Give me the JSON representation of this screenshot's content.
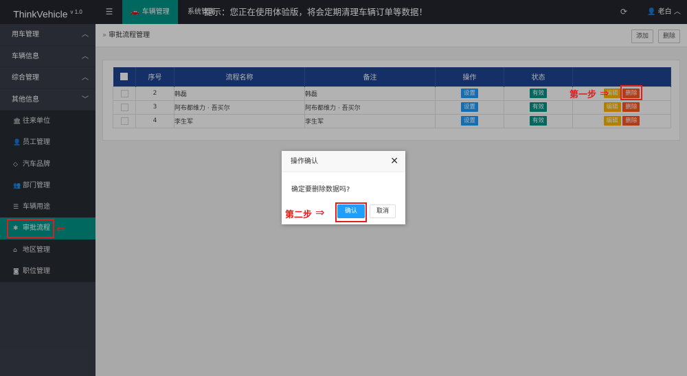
{
  "app": {
    "brand": "ThinkVehicle",
    "version": "v 1.0",
    "active_tab": "车辆管理",
    "tab2": "系统管理",
    "notice": "提示：您正在使用体验版，将会定期清理车辆订单等数据！",
    "user": "老白"
  },
  "sidebar": {
    "groups": [
      {
        "label": "用车管理"
      },
      {
        "label": "车辆信息"
      },
      {
        "label": "综合管理"
      },
      {
        "label": "其他信息"
      }
    ],
    "items": [
      {
        "label": "往来单位",
        "icon": "bank-icon"
      },
      {
        "label": "员工管理",
        "icon": "user-icon"
      },
      {
        "label": "汽车品牌",
        "icon": "diamond-icon"
      },
      {
        "label": "部门管理",
        "icon": "users-icon"
      },
      {
        "label": "车辆用途",
        "icon": "list-icon"
      },
      {
        "label": "审批流程",
        "icon": "gear-icon"
      },
      {
        "label": "地区管理",
        "icon": "home-icon"
      },
      {
        "label": "职位管理",
        "icon": "camera-icon"
      }
    ]
  },
  "page": {
    "breadcrumb": "审批流程管理",
    "add_label": "添加",
    "delete_label": "删除"
  },
  "table": {
    "headers": [
      "序号",
      "流程名称",
      "备注",
      "操作",
      "状态"
    ],
    "rows": [
      {
        "no": "2",
        "name": "韩磊",
        "note": "韩磊",
        "action": "设置",
        "status": "有效"
      },
      {
        "no": "3",
        "name": "阿布都维力 · 吾买尔",
        "note": "阿布都维力 · 吾买尔",
        "action": "设置",
        "status": "有效"
      },
      {
        "no": "4",
        "name": "李生军",
        "note": "李生军",
        "action": "设置",
        "status": "有效"
      }
    ],
    "edit_label": "编辑",
    "del_label": "删除"
  },
  "dialog": {
    "title": "操作确认",
    "message": "确定要删除数据吗?",
    "ok_label": "确认",
    "cancel_label": "取消"
  },
  "annotations": {
    "step1": "第一步",
    "step2": "第二步"
  },
  "colors": {
    "topbar": "#23262e",
    "sidebar": "#393d49",
    "accent": "#009688",
    "table_header": "#1e4594",
    "primary": "#1e9fff",
    "annotation": "#e21b1b"
  }
}
